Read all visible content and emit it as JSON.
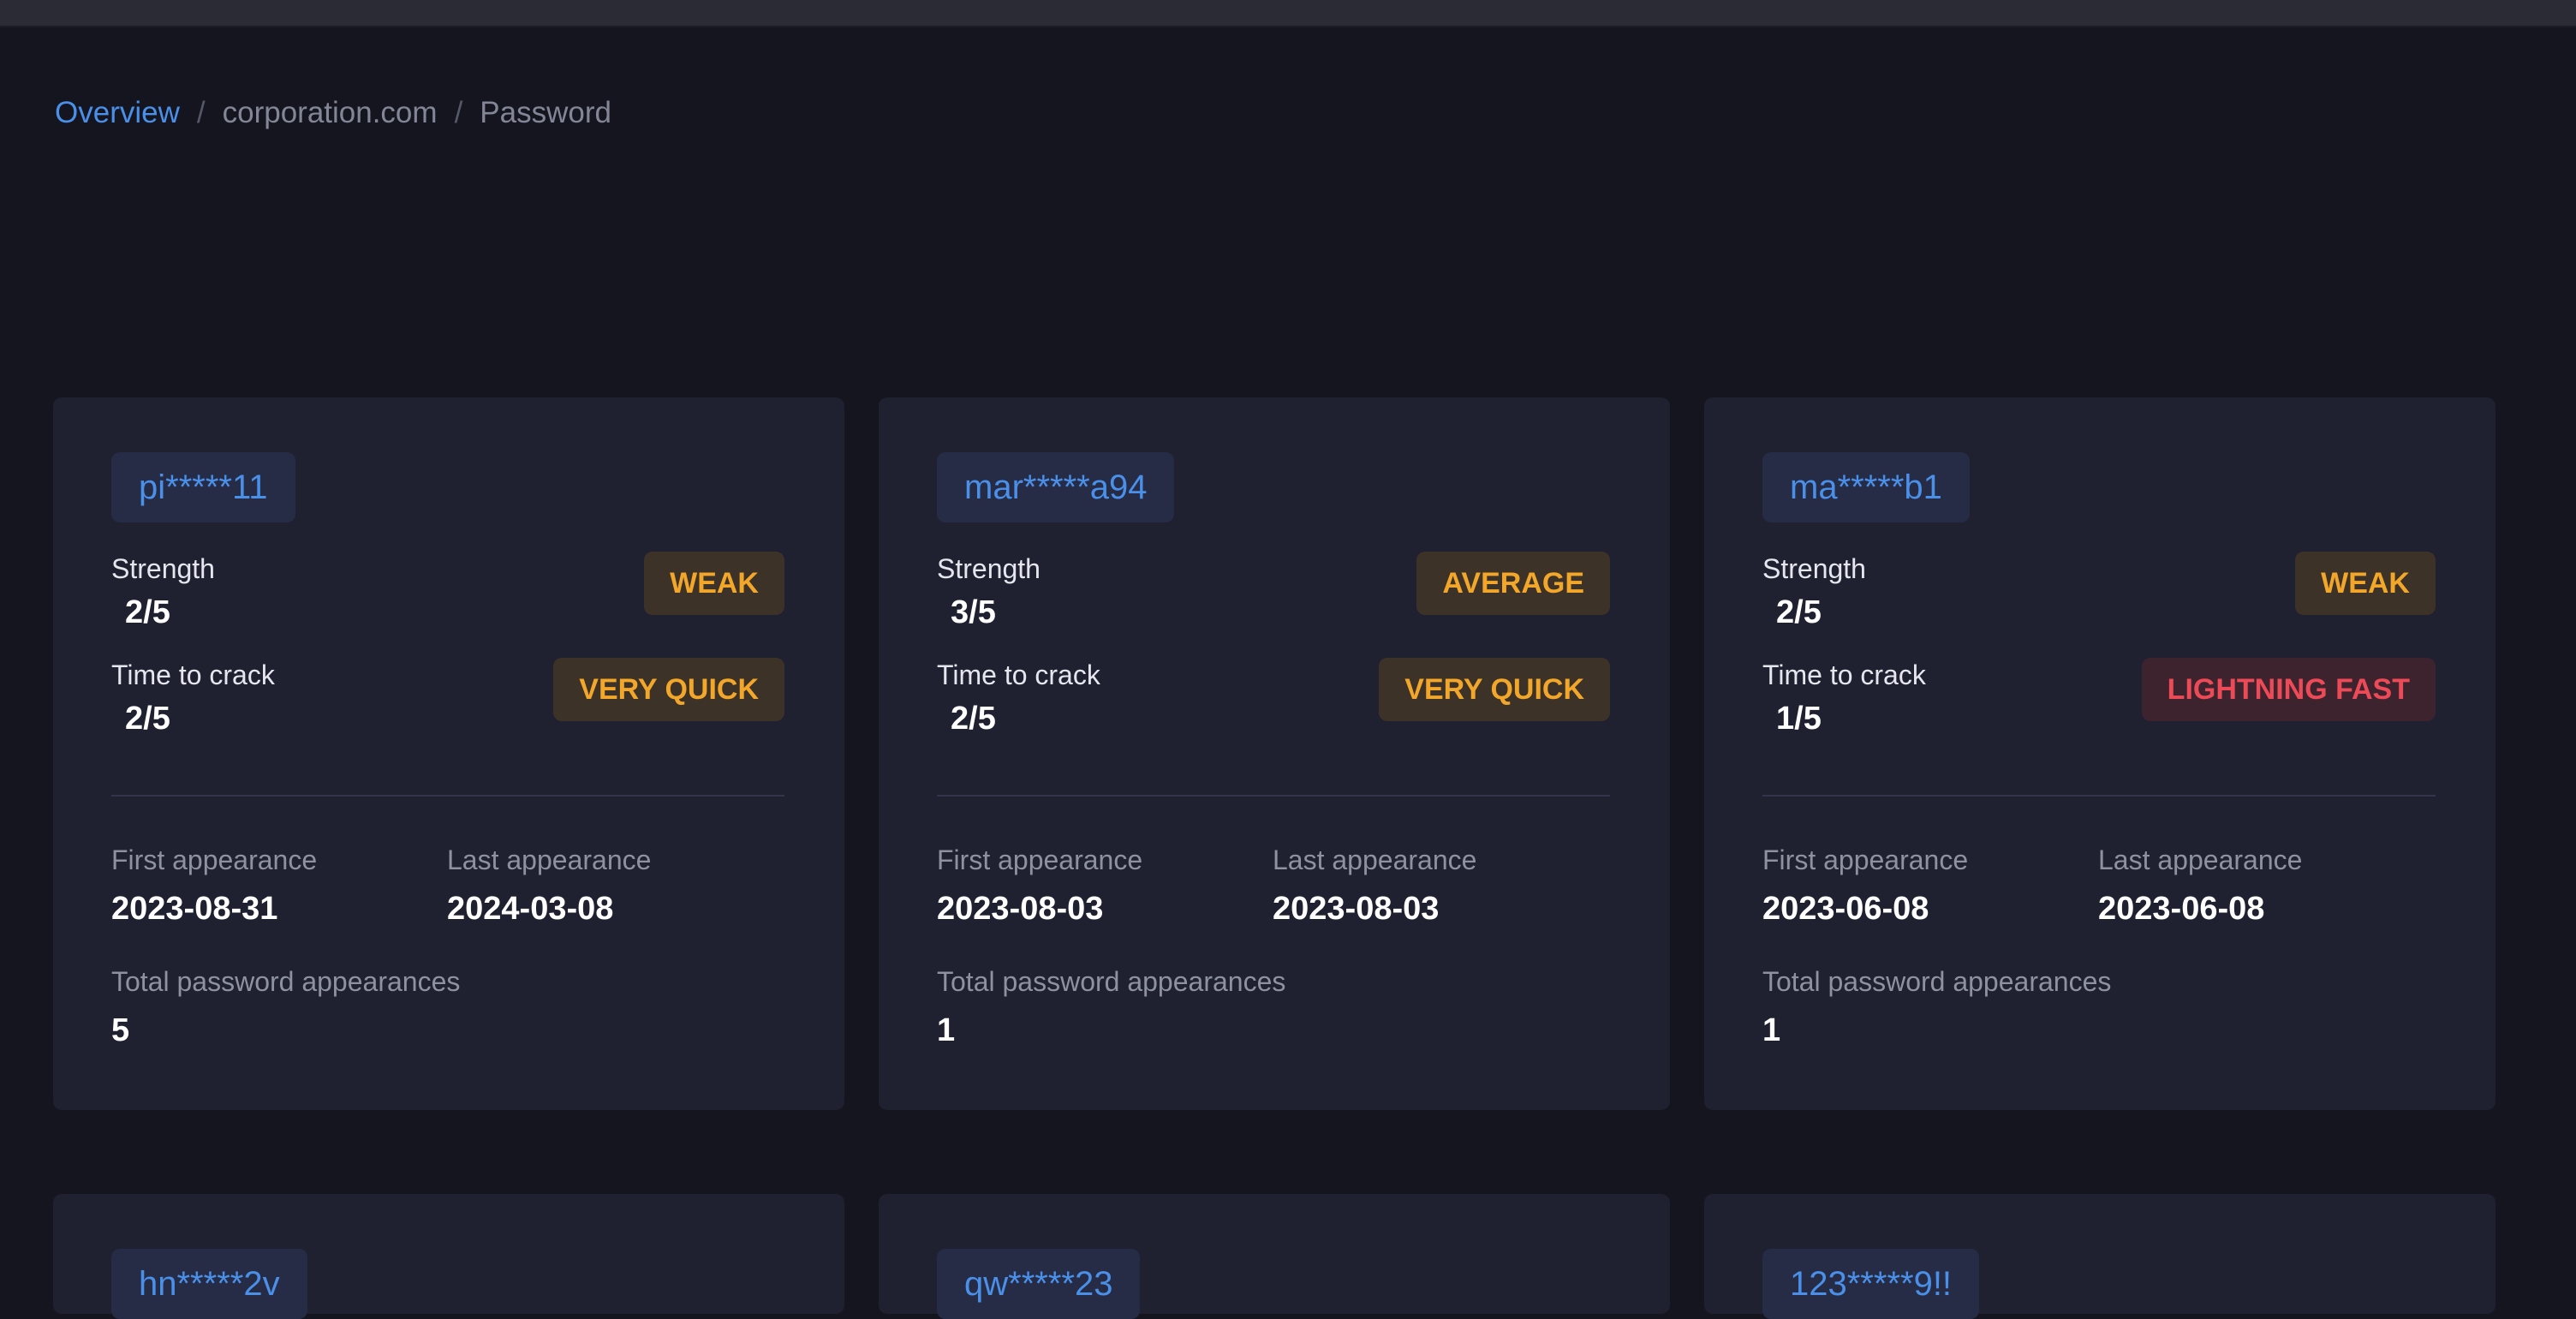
{
  "breadcrumb": {
    "overview": "Overview",
    "separator": "/",
    "domain": "corporation.com",
    "section": "Password"
  },
  "labels": {
    "strength": "Strength",
    "time_to_crack": "Time to crack",
    "first_appearance": "First appearance",
    "last_appearance": "Last appearance",
    "total_appearances": "Total password appearances"
  },
  "colors": {
    "background": "#14151f",
    "card": "#1f2030",
    "accent": "#4a8fe8",
    "amber": "#f2a62a",
    "red": "#ec4a57"
  },
  "cards": [
    {
      "password": "pi*****11",
      "strength": "2/5",
      "strength_badge": "WEAK",
      "time_to_crack": "2/5",
      "time_badge": "VERY QUICK",
      "first_appearance": "2023-08-31",
      "last_appearance": "2024-03-08",
      "total_appearances": "5"
    },
    {
      "password": "mar*****a94",
      "strength": "3/5",
      "strength_badge": "AVERAGE",
      "time_to_crack": "2/5",
      "time_badge": "VERY QUICK",
      "first_appearance": "2023-08-03",
      "last_appearance": "2023-08-03",
      "total_appearances": "1"
    },
    {
      "password": "ma*****b1",
      "strength": "2/5",
      "strength_badge": "WEAK",
      "time_to_crack": "1/5",
      "time_badge": "LIGHTNING FAST",
      "first_appearance": "2023-06-08",
      "last_appearance": "2023-06-08",
      "total_appearances": "1"
    },
    {
      "password": "hn*****2v"
    },
    {
      "password": "qw*****23"
    },
    {
      "password": "123*****9!!"
    }
  ]
}
